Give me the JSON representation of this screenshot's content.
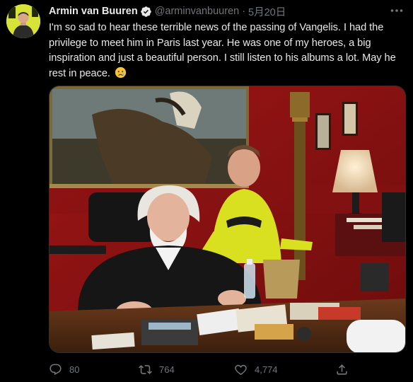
{
  "tweet": {
    "author_name": "Armin van Buuren",
    "handle": "@arminvanbuuren",
    "separator": "·",
    "date": "5月20日",
    "text": "I'm so sad to hear these terrible news of the passing of Vangelis. I had the privilege to meet him in Paris last year. He was one of my heroes, a big inspiration and just a beautiful person. I still listen to his albums a lot. May he rest in peace.",
    "emoji": "crying-face-emoji"
  },
  "actions": {
    "reply_count": "80",
    "retweet_count": "764",
    "like_count": "4,774"
  },
  "icons": {
    "verified": "verified-badge-icon",
    "more": "more-options-icon",
    "reply": "reply-icon",
    "retweet": "retweet-icon",
    "like": "like-icon",
    "share": "share-icon"
  },
  "colors": {
    "background": "#000000",
    "primary_text": "#e7e9ea",
    "secondary_text": "#71767b",
    "verified": "#1d9bf0",
    "avatar_accent": "#d8e33a"
  }
}
